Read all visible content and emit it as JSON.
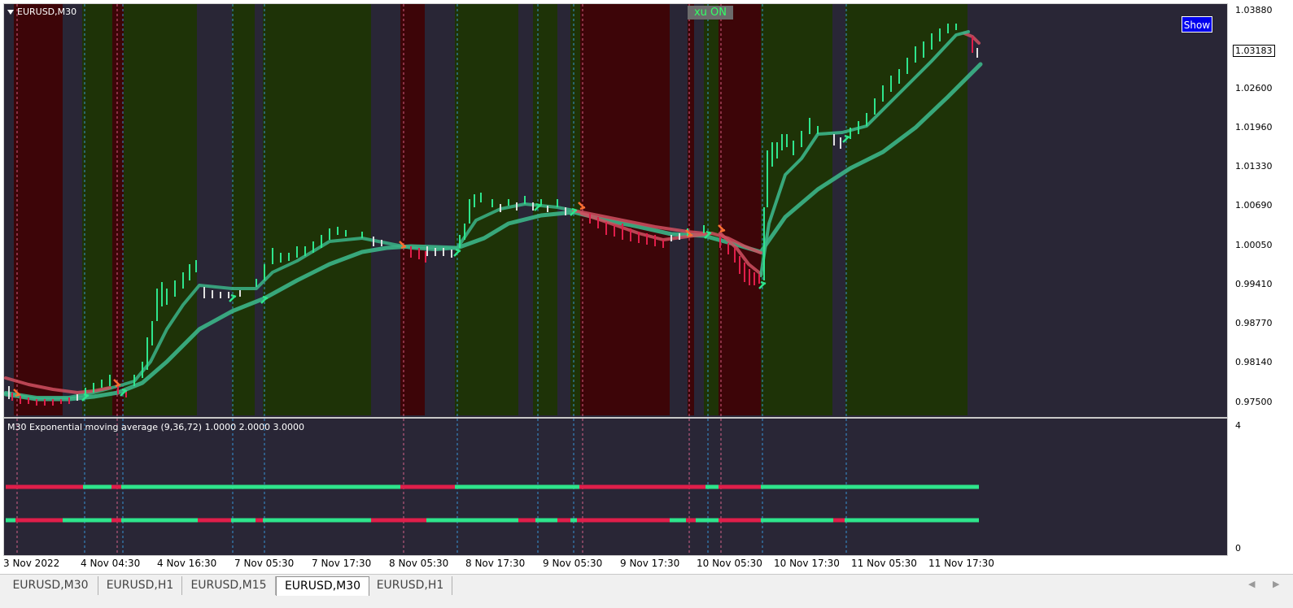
{
  "chart": {
    "symbol_title": "EURUSD,M30",
    "badge": "xu ON",
    "show_button": "Show",
    "current_price": "1.03183",
    "price_axis": [
      "1.03880",
      "1.02600",
      "1.01960",
      "1.01330",
      "1.00690",
      "1.00050",
      "0.99410",
      "0.98770",
      "0.98140",
      "0.97500"
    ],
    "subwindow_title": "M30 Exponential moving average (9,36,72) 1.0000 2.0000 3.0000",
    "subwindow_axis": {
      "top": "4",
      "bottom": "0"
    },
    "time_axis": [
      "3 Nov 2022",
      "4 Nov 04:30",
      "4 Nov 16:30",
      "7 Nov 05:30",
      "7 Nov 17:30",
      "8 Nov 05:30",
      "8 Nov 17:30",
      "9 Nov 05:30",
      "9 Nov 17:30",
      "10 Nov 05:30",
      "10 Nov 17:30",
      "11 Nov 05:30",
      "11 Nov 17:30"
    ],
    "colors": {
      "bull": "#2ee58c",
      "bear": "#e01e4a",
      "bull_zone": "#1e3307",
      "bear_zone": "#3d0508",
      "neutral_zone": "#292636",
      "ema_fast": "#d05060",
      "ema_mid": "#3bb588"
    }
  },
  "tabs": [
    "EURUSD,M30",
    "EURUSD,H1",
    "EURUSD,M15",
    "EURUSD,M30",
    "EURUSD,H1"
  ],
  "active_tab_index": 3,
  "chart_data": {
    "type": "line",
    "title": "EURUSD,M30",
    "x": [
      "3 Nov 2022",
      "4 Nov 04:30",
      "4 Nov 16:30",
      "7 Nov 05:30",
      "7 Nov 17:30",
      "8 Nov 05:30",
      "8 Nov 17:30",
      "9 Nov 05:30",
      "9 Nov 17:30",
      "10 Nov 05:30",
      "10 Nov 17:30",
      "11 Nov 05:30",
      "11 Nov 17:30"
    ],
    "series": [
      {
        "name": "",
        "values": [
          0.9758,
          0.978,
          0.995,
          0.9935,
          1.003,
          1.001,
          1.0085,
          1.008,
          1.003,
          1.004,
          1.017,
          1.0185,
          1.036
        ]
      }
    ],
    "ylim": [
      0.975,
      1.0388
    ]
  }
}
